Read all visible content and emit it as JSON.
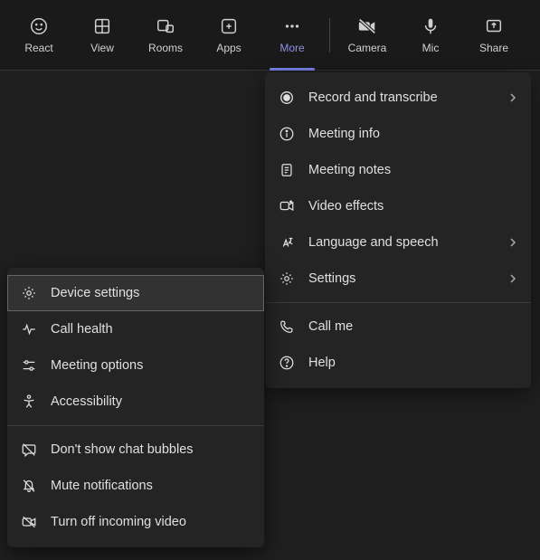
{
  "toolbar": {
    "react": "React",
    "view": "View",
    "rooms": "Rooms",
    "apps": "Apps",
    "more": "More",
    "camera": "Camera",
    "mic": "Mic",
    "share": "Share"
  },
  "moreMenu": {
    "record": "Record and transcribe",
    "meetingInfo": "Meeting info",
    "meetingNotes": "Meeting notes",
    "videoEffects": "Video effects",
    "languageSpeech": "Language and speech",
    "settings": "Settings",
    "callMe": "Call me",
    "help": "Help"
  },
  "settingsSubMenu": {
    "deviceSettings": "Device settings",
    "callHealth": "Call health",
    "meetingOptions": "Meeting options",
    "accessibility": "Accessibility",
    "chatBubbles": "Don't show chat bubbles",
    "muteNotifications": "Mute notifications",
    "turnOffVideo": "Turn off incoming video"
  }
}
